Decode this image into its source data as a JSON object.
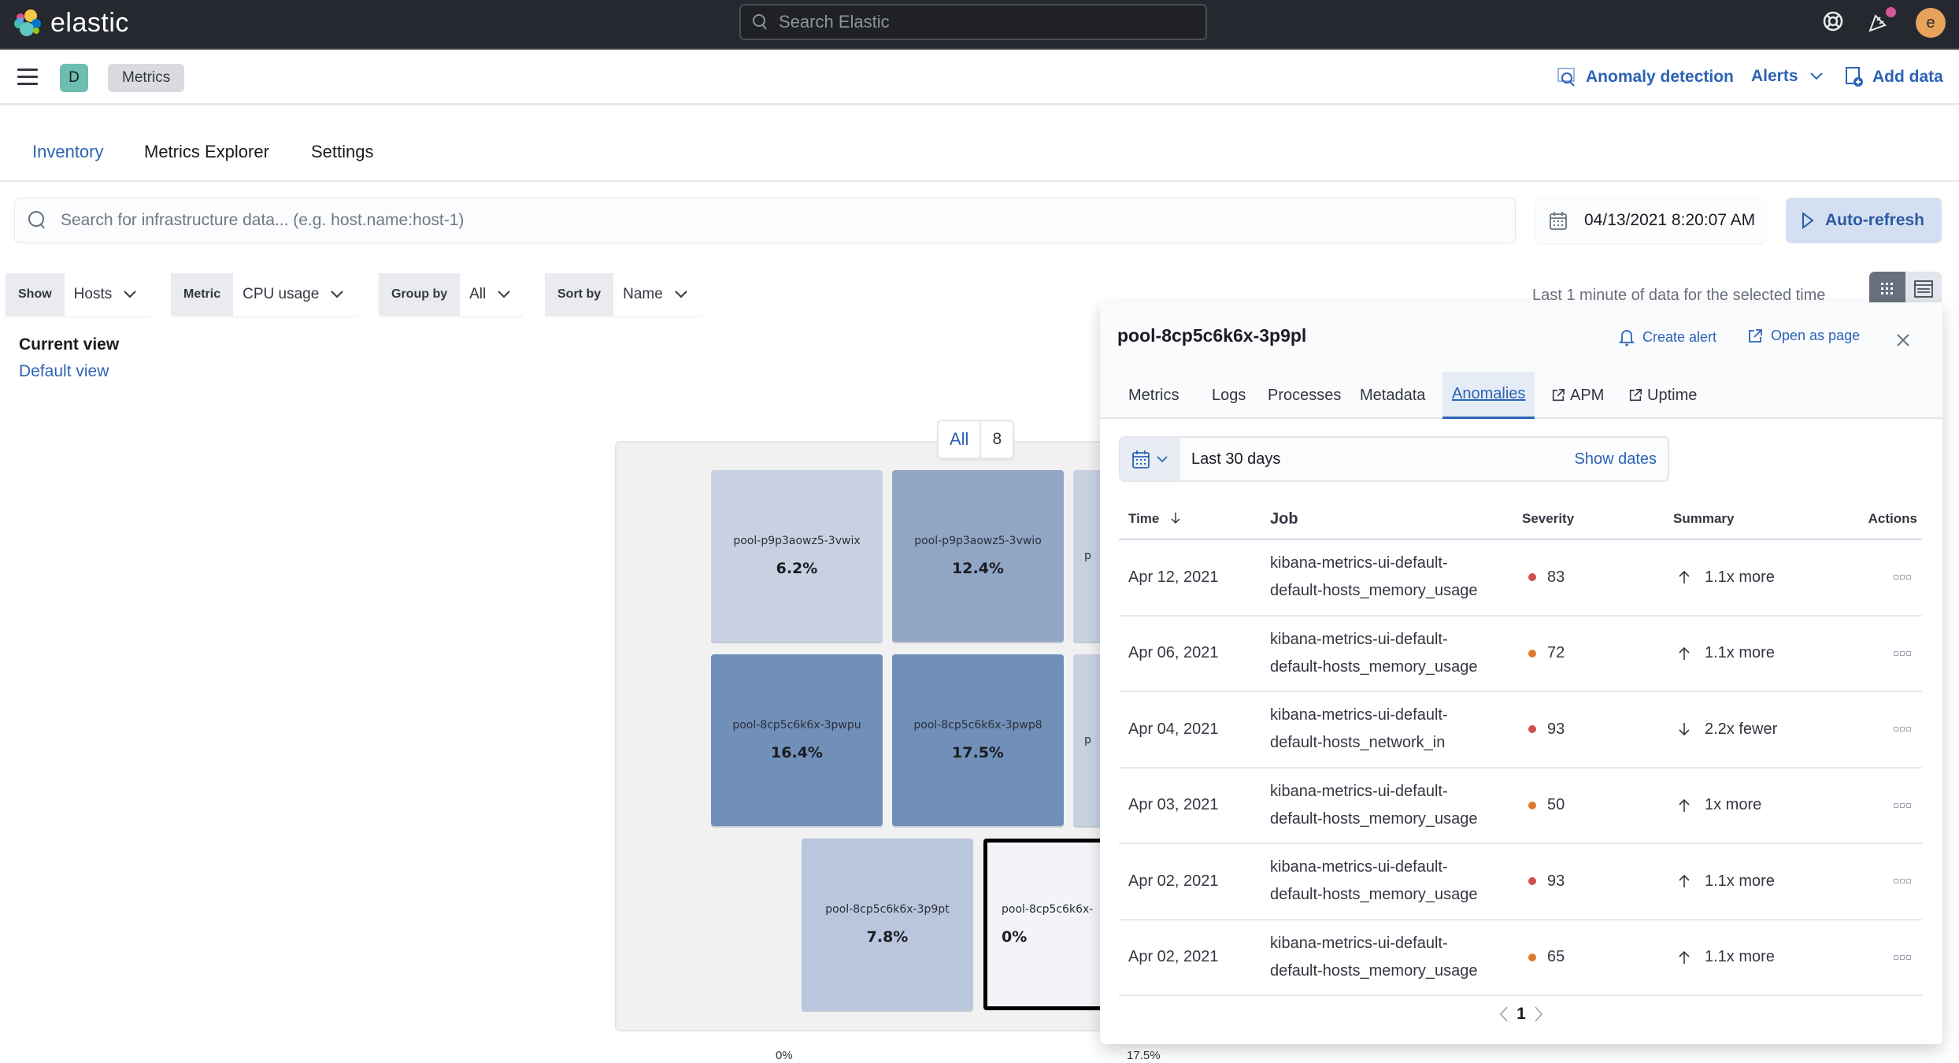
{
  "header": {
    "brand": "elastic",
    "search_placeholder": "Search Elastic",
    "avatar_initial": "e"
  },
  "subheader": {
    "space_initial": "D",
    "breadcrumb": "Metrics",
    "links": {
      "anomaly_detection": "Anomaly detection",
      "alerts": "Alerts",
      "add_data": "Add data"
    }
  },
  "tabs": [
    {
      "label": "Inventory",
      "active": true
    },
    {
      "label": "Metrics Explorer",
      "active": false
    },
    {
      "label": "Settings",
      "active": false
    }
  ],
  "search": {
    "placeholder": "Search for infrastructure data... (e.g. host.name:host-1)"
  },
  "date_picker": {
    "value": "04/13/2021 8:20:07 AM"
  },
  "auto_refresh_label": "Auto-refresh",
  "filters": [
    {
      "label": "Show",
      "value": "Hosts"
    },
    {
      "label": "Metric",
      "value": "CPU usage"
    },
    {
      "label": "Group by",
      "value": "All"
    },
    {
      "label": "Sort by",
      "value": "Name"
    }
  ],
  "saved_view": {
    "label": "Current view",
    "value": "Default view"
  },
  "data_range_note": "Last 1 minute of data for the selected time",
  "map": {
    "group_name": "All",
    "group_count": "8",
    "tiles": [
      {
        "name": "pool-p9p3aowz5-3vwix",
        "value": "6.2%",
        "color": "#c8d1e1"
      },
      {
        "name": "pool-p9p3aowz5-3vwio",
        "value": "12.4%",
        "color": "#91a5c5"
      },
      {
        "name": "p",
        "value": "",
        "color": "#c8d1e1"
      },
      {
        "name": "pool-8cp5c6k6x-3pwpu",
        "value": "16.4%",
        "color": "#7190b9"
      },
      {
        "name": "pool-8cp5c6k6x-3pwp8",
        "value": "17.5%",
        "color": "#7190b9"
      },
      {
        "name": "p",
        "value": "",
        "color": "#c8d1e1"
      },
      {
        "name": "pool-8cp5c6k6x-3p9pt",
        "value": "7.8%",
        "color": "#b9c6dd"
      },
      {
        "name": "pool-8cp5c6k6x-",
        "value": "0%",
        "color": "#f2f4f8"
      }
    ],
    "legend": {
      "min": "0%",
      "max": "17.5%"
    }
  },
  "flyout": {
    "title": "pool-8cp5c6k6x-3p9pl",
    "create_alert": "Create alert",
    "open_as_page": "Open as page",
    "tabs": [
      {
        "label": "Metrics",
        "active": false,
        "external": false
      },
      {
        "label": "Logs",
        "active": false,
        "external": false
      },
      {
        "label": "Processes",
        "active": false,
        "external": false
      },
      {
        "label": "Metadata",
        "active": false,
        "external": false
      },
      {
        "label": "Anomalies",
        "active": true,
        "external": false
      },
      {
        "label": "APM",
        "active": false,
        "external": true
      },
      {
        "label": "Uptime",
        "active": false,
        "external": true
      }
    ],
    "range": {
      "value": "Last 30 days",
      "show_dates": "Show dates"
    },
    "table": {
      "columns": [
        "Time",
        "Job",
        "Severity",
        "Summary",
        "Actions"
      ],
      "rows": [
        {
          "time": "Apr 12, 2021",
          "job_1": "kibana-metrics-ui-default-",
          "job_2": "default-hosts_memory_usage",
          "severity": "83",
          "severity_color": "#d0504a",
          "direction": "up",
          "summary": "1.1x more"
        },
        {
          "time": "Apr 06, 2021",
          "job_1": "kibana-metrics-ui-default-",
          "job_2": "default-hosts_memory_usage",
          "severity": "72",
          "severity_color": "#e0782c",
          "direction": "up",
          "summary": "1.1x more"
        },
        {
          "time": "Apr 04, 2021",
          "job_1": "kibana-metrics-ui-default-",
          "job_2": "default-hosts_network_in",
          "severity": "93",
          "severity_color": "#d0504a",
          "direction": "down",
          "summary": "2.2x fewer"
        },
        {
          "time": "Apr 03, 2021",
          "job_1": "kibana-metrics-ui-default-",
          "job_2": "default-hosts_memory_usage",
          "severity": "50",
          "severity_color": "#e0782c",
          "direction": "up",
          "summary": "1x more"
        },
        {
          "time": "Apr 02, 2021",
          "job_1": "kibana-metrics-ui-default-",
          "job_2": "default-hosts_memory_usage",
          "severity": "93",
          "severity_color": "#d0504a",
          "direction": "up",
          "summary": "1.1x more"
        },
        {
          "time": "Apr 02, 2021",
          "job_1": "kibana-metrics-ui-default-",
          "job_2": "default-hosts_memory_usage",
          "severity": "65",
          "severity_color": "#e0782c",
          "direction": "up",
          "summary": "1.1x more"
        }
      ]
    },
    "pagination": {
      "current_page": "1"
    }
  },
  "colors": {
    "accent": "#2c63b5",
    "header_bg": "#25282f"
  }
}
